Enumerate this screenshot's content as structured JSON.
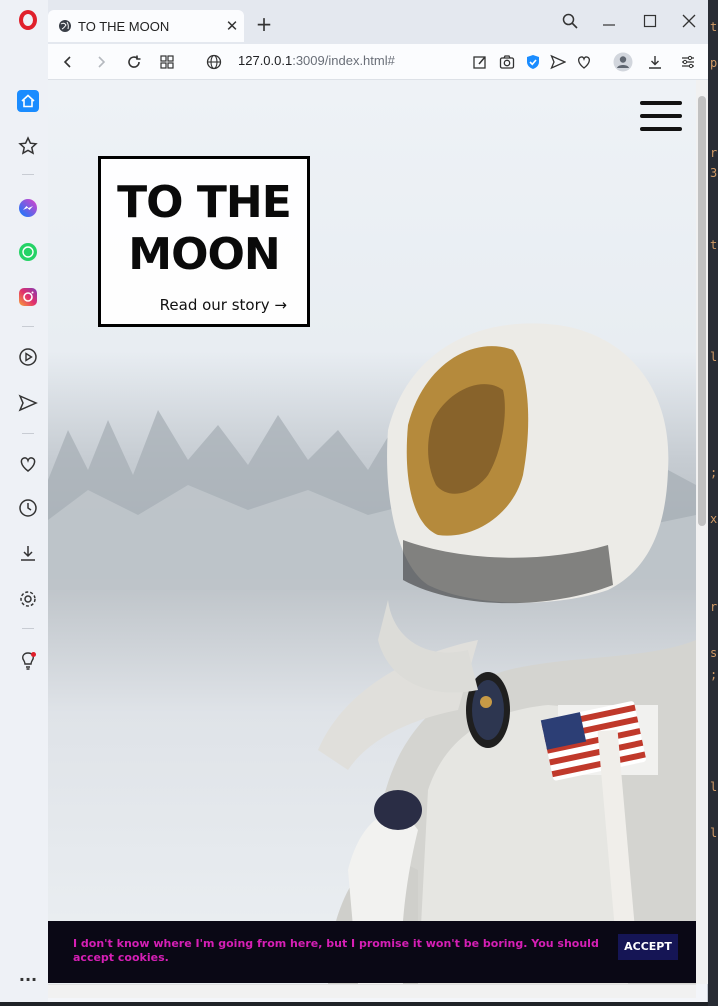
{
  "browser": {
    "tab": {
      "title": "TO THE MOON",
      "close": "✕"
    },
    "new_tab": "+",
    "url": {
      "host": "127.0.0.1",
      "rest": ":3009/index.html#"
    }
  },
  "sidebar": {
    "items": [
      "home",
      "bookmarks",
      "messenger",
      "whatsapp",
      "instagram",
      "player",
      "flow",
      "favorites",
      "history",
      "downloads",
      "settings",
      "tips"
    ],
    "more": "···"
  },
  "page": {
    "title_line1": "TO THE",
    "title_line2": "MOON",
    "story_link": "Read our story →",
    "cookie_text": "I don't know where I'm going from here, but I promise it won't be boring. You should accept cookies.",
    "accept_label": "ACCEPT"
  },
  "colors": {
    "cookie_text": "#d61fb5",
    "cookie_bg": "#0a0815",
    "accept_bg": "#151555",
    "opera_red": "#e0202b",
    "active_sidebar": "#1a8cff"
  }
}
